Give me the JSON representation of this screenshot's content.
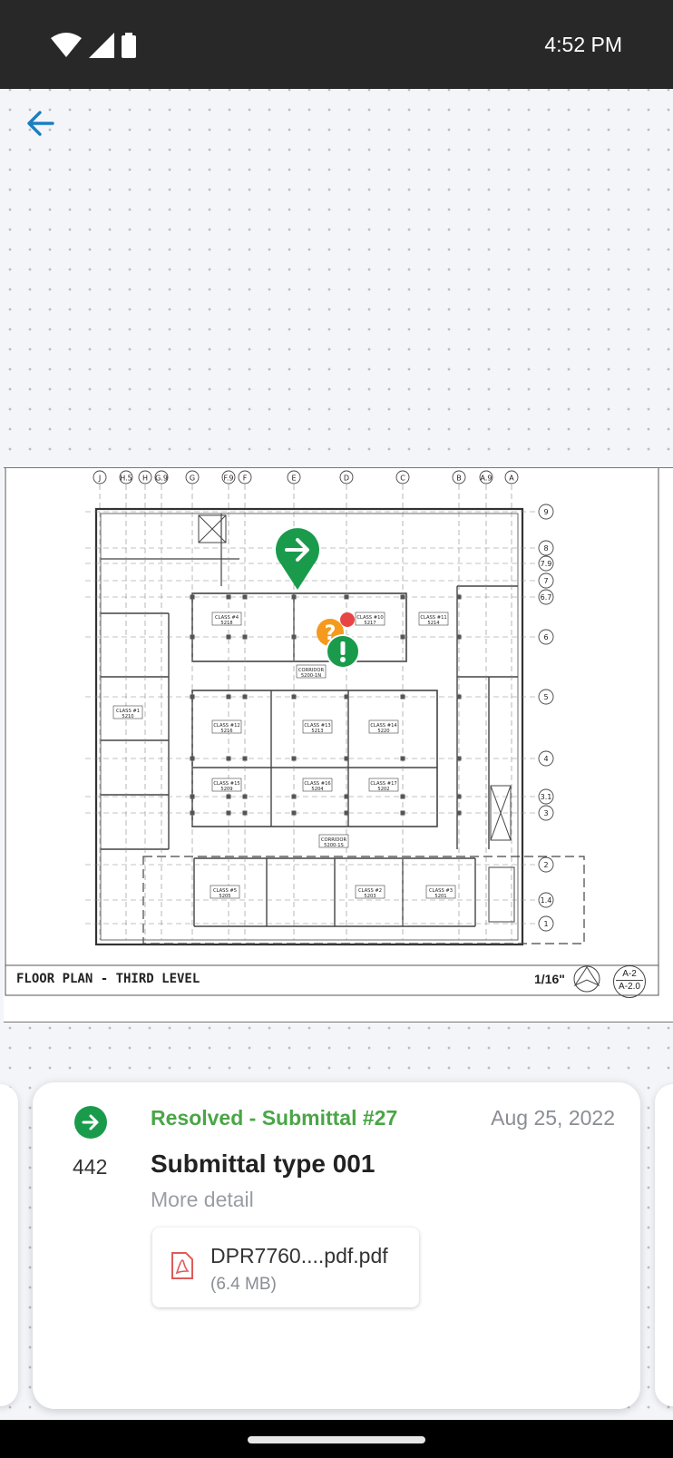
{
  "status_bar": {
    "time": "4:52 PM"
  },
  "drawing": {
    "title": "FLOOR PLAN - THIRD LEVEL",
    "scale": "1/16\"",
    "sheet_top": "A-2",
    "sheet_bottom": "A-2.0",
    "grid_cols": [
      "J",
      "H.5",
      "H",
      "G.9",
      "G",
      "F.9",
      "F",
      "E",
      "D",
      "C",
      "B",
      "A.9",
      "A"
    ],
    "grid_rows": [
      "9",
      "8",
      "7.9",
      "7",
      "6.7",
      "6",
      "5",
      "4",
      "3.1",
      "3",
      "2",
      "1.4",
      "1"
    ],
    "rooms": [
      {
        "name": "CLASS #4",
        "num": "5218"
      },
      {
        "name": "CLASS #10",
        "num": "5217"
      },
      {
        "name": "CLASS #11",
        "num": "5214"
      },
      {
        "name": "CLASS #12",
        "num": "5216"
      },
      {
        "name": "CLASS #13",
        "num": "5213"
      },
      {
        "name": "CLASS #14",
        "num": "5220"
      },
      {
        "name": "CLASS #15",
        "num": "5209"
      },
      {
        "name": "CLASS #16",
        "num": "5204"
      },
      {
        "name": "CLASS #17",
        "num": "5202"
      },
      {
        "name": "CLASS #1",
        "num": "5210"
      },
      {
        "name": "CLASS #2",
        "num": "5203"
      },
      {
        "name": "CLASS #3",
        "num": "5201"
      },
      {
        "name": "CLASS #5",
        "num": "5205"
      },
      {
        "name": "CORRIDOR",
        "num": "5200-1N"
      },
      {
        "name": "CORRIDOR",
        "num": "5200-1S"
      }
    ],
    "colors": {
      "resolved_pin": "#1a9b4c",
      "question_pin": "#f59a1c",
      "alert_dot": "#e84444"
    }
  },
  "card": {
    "status_icon": "arrow-right-circle-icon",
    "number": "442",
    "status_title": "Resolved - Submittal #27",
    "date": "Aug 25, 2022",
    "title": "Submittal type 001",
    "detail": "More detail",
    "attachment": {
      "icon": "pdf-file-icon",
      "file_name": "DPR7760....pdf.pdf",
      "file_size": "(6.4 MB)"
    }
  },
  "colors": {
    "accent": "#1a7fc1",
    "resolved": "#4aa646",
    "resolved_icon": "#1a9b4c"
  }
}
